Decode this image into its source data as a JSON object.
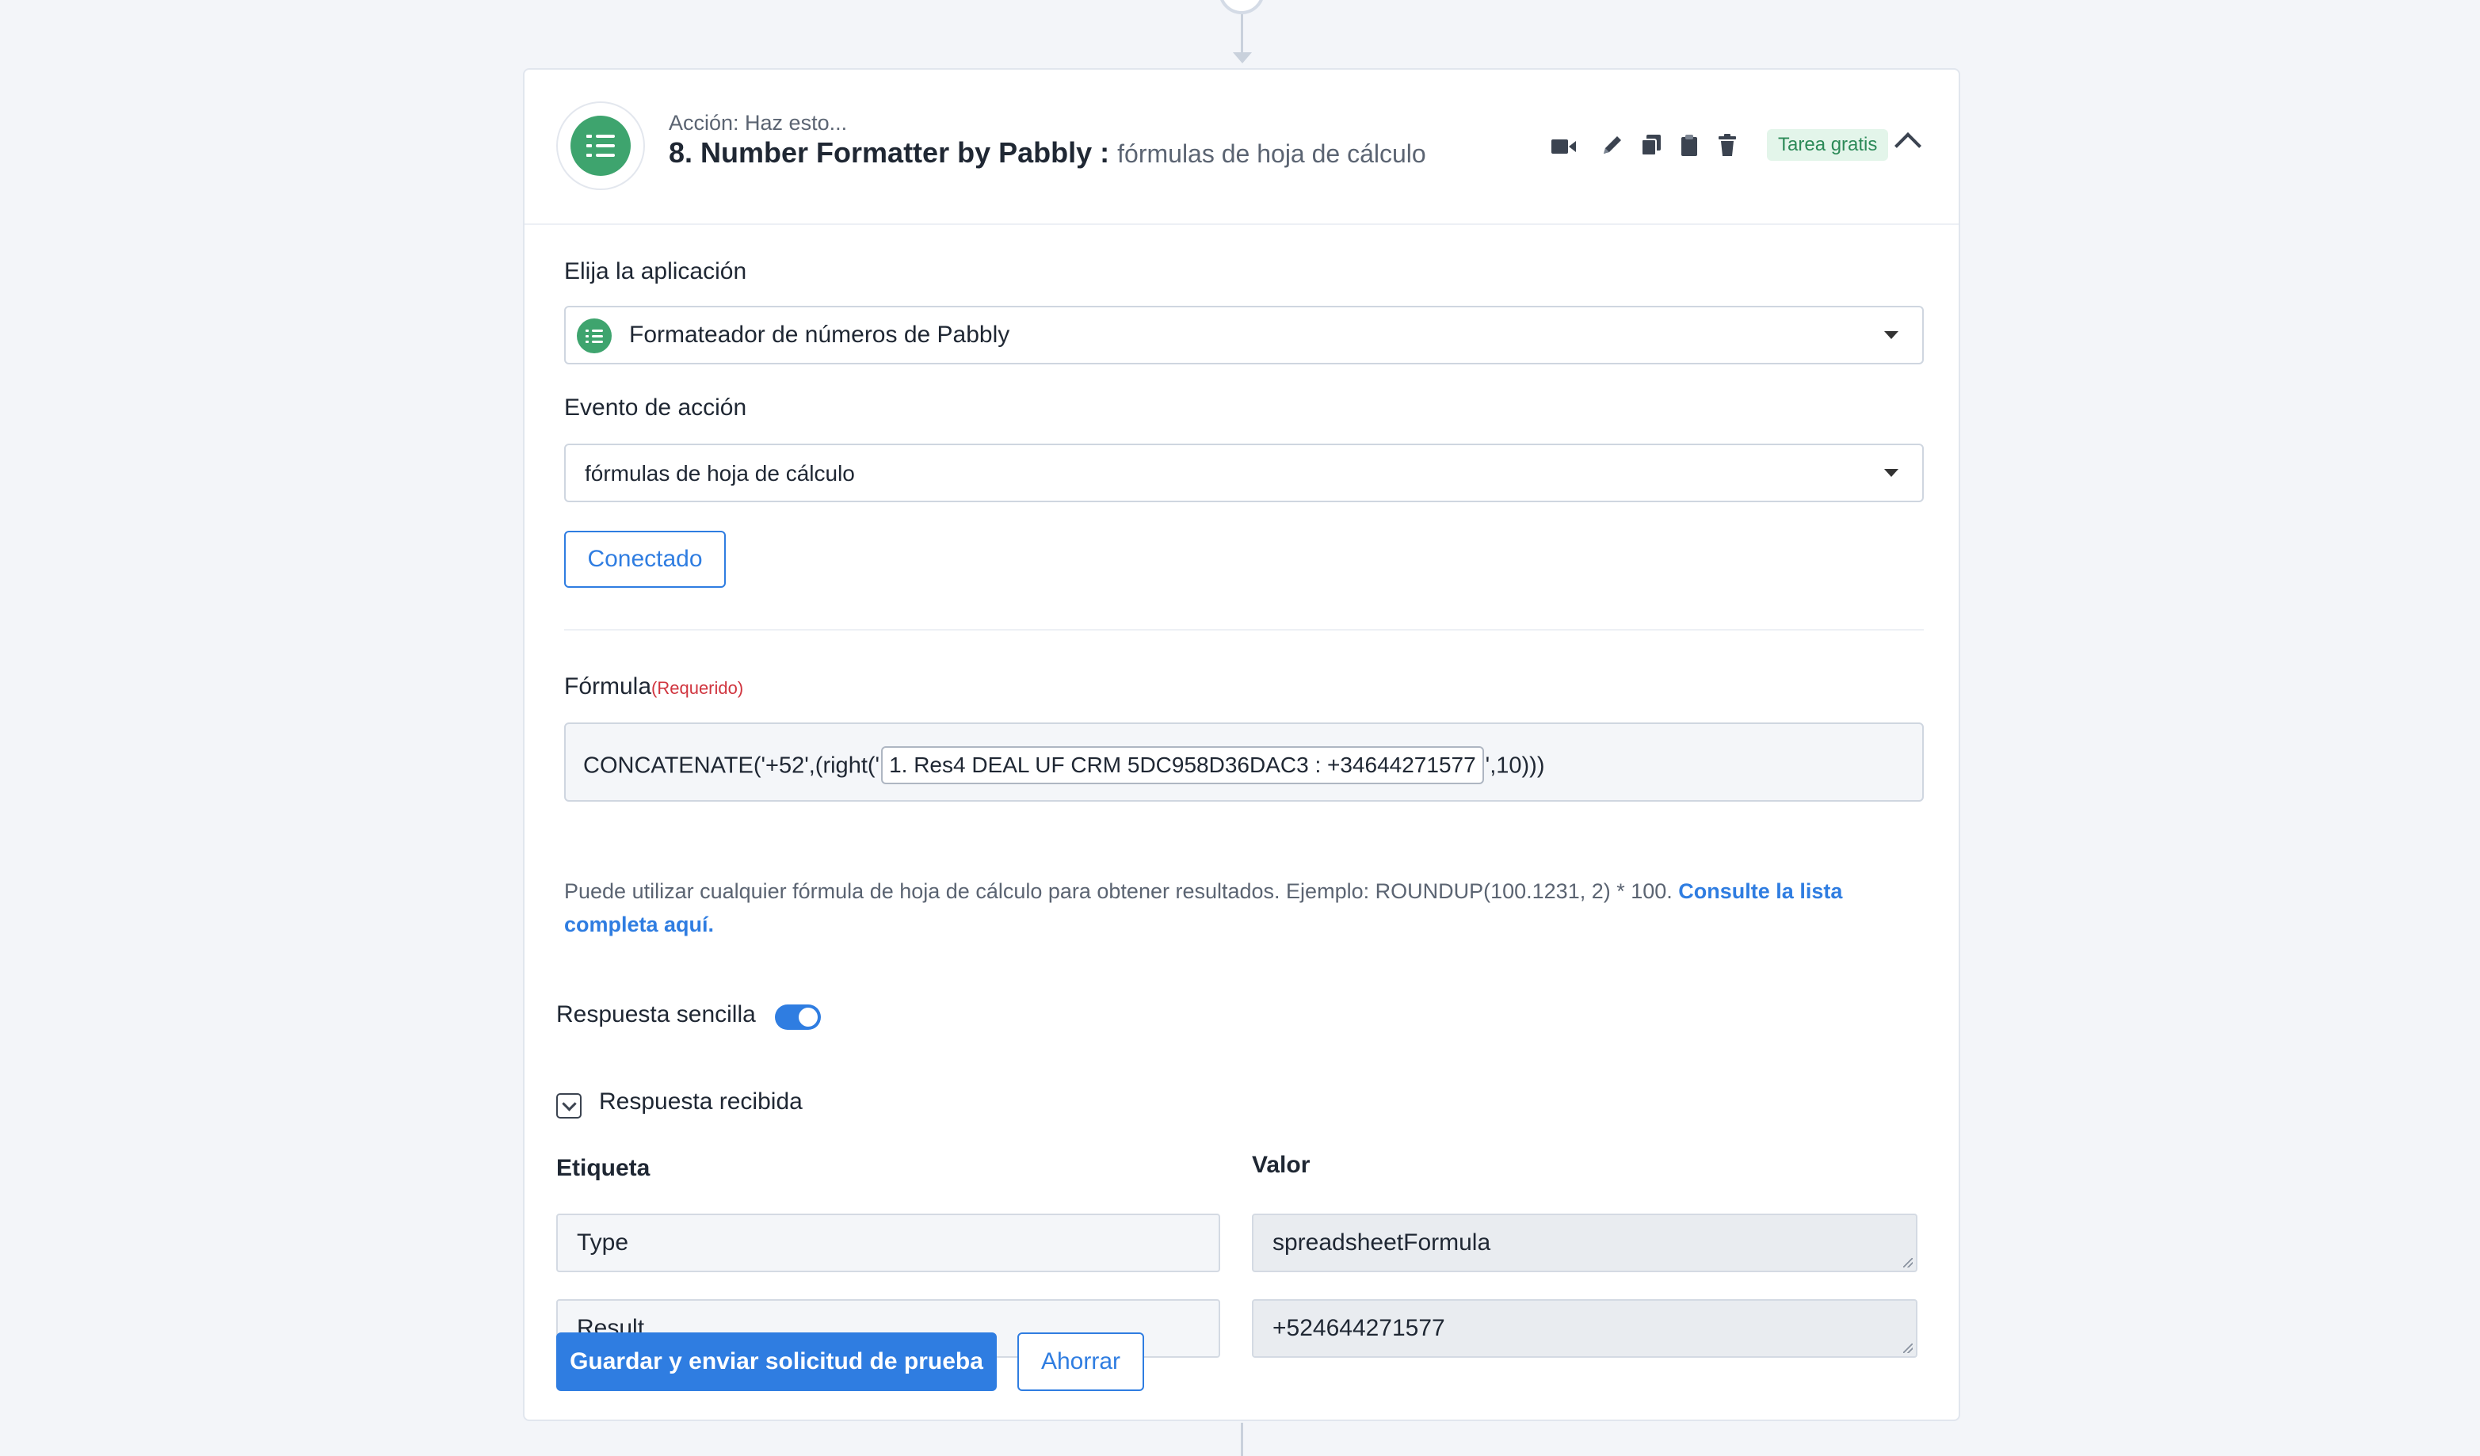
{
  "header": {
    "action_label": "Acción: Haz esto...",
    "step_title": "8. Number Formatter by Pabbly :",
    "step_subtitle": "fórmulas de hoja de cálculo",
    "badge": "Tarea gratis",
    "app_icon": "numbered-list-icon",
    "tools": [
      "video-icon",
      "pencil-icon",
      "copy-icon",
      "clipboard-icon",
      "trash-icon",
      "chevron-up-icon"
    ]
  },
  "app_select": {
    "label": "Elija la aplicación",
    "value": "Formateador de números de Pabbly"
  },
  "event_select": {
    "label": "Evento de acción",
    "value": "fórmulas de hoja de cálculo"
  },
  "connected_button": "Conectado",
  "formula": {
    "label": "Fórmula",
    "required": "(Requerido)",
    "prefix": "CONCATENATE('+52',(right('",
    "token": "1. Res4 DEAL UF CRM 5DC958D36DAC3 : +34644271577",
    "suffix": "',10)))",
    "help_text": "Puede utilizar cualquier fórmula de hoja de cálculo para obtener resultados. Ejemplo: ROUNDUP(100.1231, 2) * 100.",
    "help_link": "Consulte la lista completa aquí."
  },
  "simple_response": {
    "label": "Respuesta sencilla",
    "enabled": true
  },
  "received": {
    "label": "Respuesta recibida",
    "col_label": "Etiqueta",
    "col_value": "Valor",
    "rows": [
      {
        "label": "Type",
        "value": "spreadsheetFormula"
      },
      {
        "label": "Result",
        "value": "+524644271577"
      }
    ]
  },
  "buttons": {
    "save_test": "Guardar y enviar solicitud de prueba",
    "save": "Ahorrar"
  },
  "colors": {
    "accent": "#2f7de1",
    "app_green": "#3ea46e",
    "required_red": "#d0353f"
  }
}
